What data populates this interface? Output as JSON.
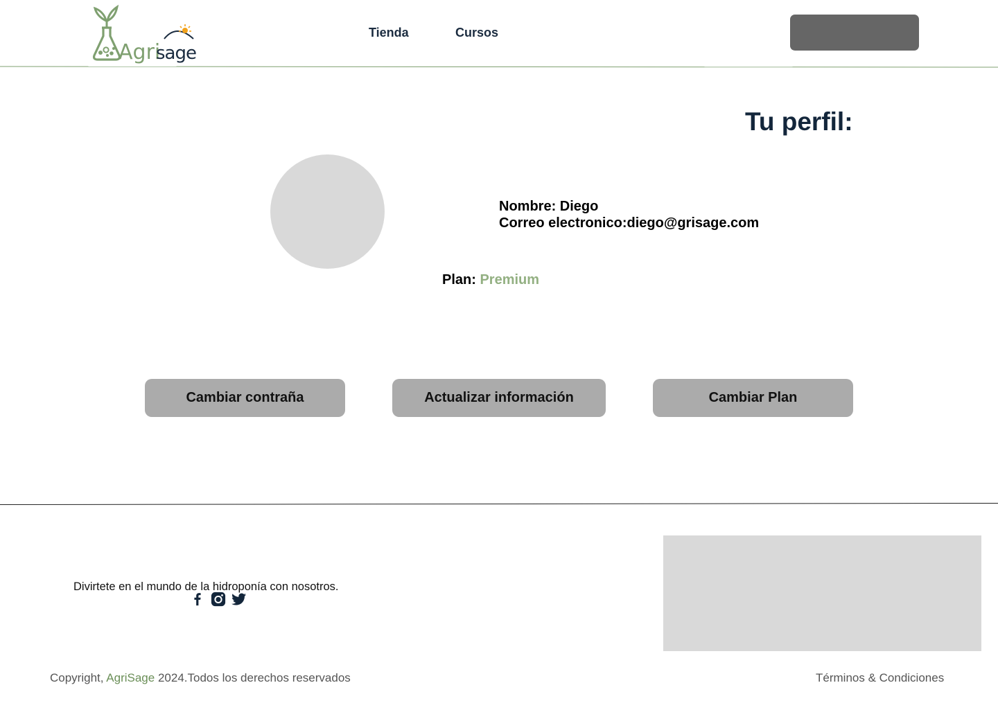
{
  "header": {
    "logo_alt": "AgriSage",
    "logo_text_green": "Agri",
    "logo_text_dark": "sage",
    "nav": [
      {
        "label": "Tienda"
      },
      {
        "label": "Cursos"
      }
    ]
  },
  "profile": {
    "title": "Tu perfil:",
    "name_label": "Nombre: Diego",
    "email_label": "Correo electronico:diego@grisage.com",
    "plan_label": "Plan:",
    "plan_value": "Premium"
  },
  "actions": {
    "change_password": "Cambiar contraña",
    "update_info": "Actualizar información",
    "change_plan": "Cambiar Plan"
  },
  "footer": {
    "tagline": "Divirtete en el mundo de la hidroponía con nosotros.",
    "copyright_prefix": "Copyright,",
    "brand": "AgriSage",
    "copyright_suffix": "2024.Todos los derechos reservados",
    "terms": "Términos & Condiciones",
    "socials": [
      "facebook-icon",
      "instagram-icon",
      "twitter-icon"
    ]
  },
  "colors": {
    "brand_green": "#7fa070",
    "plan_green": "#93b082",
    "title_navy": "#13263b",
    "button_gray": "#ababab",
    "header_button": "#666666"
  }
}
